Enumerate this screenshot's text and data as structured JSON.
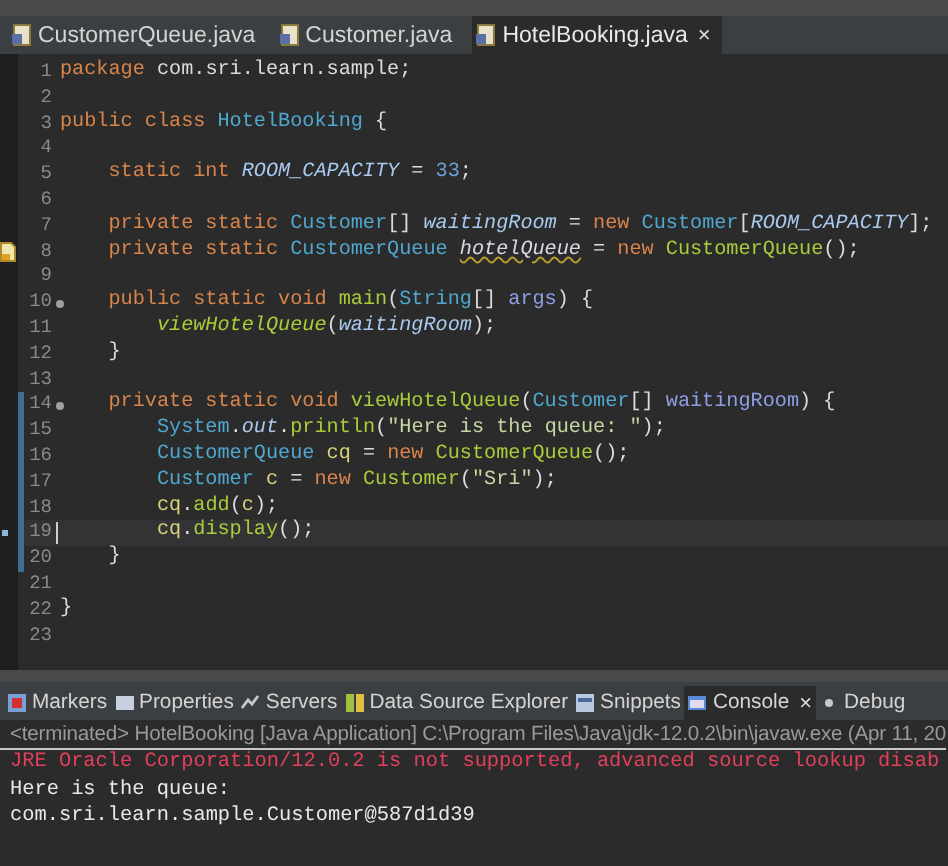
{
  "editor_tabs": [
    {
      "label": "CustomerQueue.java",
      "selected": false
    },
    {
      "label": "Customer.java",
      "selected": false
    },
    {
      "label": "HotelBooking.java",
      "selected": true,
      "close": "×"
    }
  ],
  "code_lines": [
    {
      "number": "1",
      "tokens": [
        {
          "kind": "keyword",
          "text": "package"
        },
        {
          "kind": "plain",
          "text": " com.sri.learn.sample;"
        }
      ]
    },
    {
      "number": "2"
    },
    {
      "number": "3",
      "tokens": [
        {
          "kind": "keyword",
          "text": "public class "
        },
        {
          "kind": "type",
          "text": "HotelBooking"
        },
        {
          "kind": "plain",
          "text": " {"
        }
      ]
    },
    {
      "number": "4"
    },
    {
      "number": "5",
      "tokens": [
        {
          "kind": "keyword",
          "text": "    static int "
        },
        {
          "kind": "static-field",
          "text": "ROOM_CAPACITY"
        },
        {
          "kind": "plain",
          "text": " = "
        },
        {
          "kind": "number",
          "text": "33"
        },
        {
          "kind": "plain",
          "text": ";"
        }
      ]
    },
    {
      "number": "6"
    },
    {
      "number": "7",
      "tokens": [
        {
          "kind": "keyword",
          "text": "    private static "
        },
        {
          "kind": "type",
          "text": "Customer"
        },
        {
          "kind": "plain",
          "text": "[] "
        },
        {
          "kind": "static-field",
          "text": "waitingRoom"
        },
        {
          "kind": "plain",
          "text": " = "
        },
        {
          "kind": "keyword",
          "text": "new "
        },
        {
          "kind": "type",
          "text": "Customer"
        },
        {
          "kind": "plain",
          "text": "["
        },
        {
          "kind": "static-field",
          "text": "ROOM_CAPACITY"
        },
        {
          "kind": "plain",
          "text": "];"
        }
      ]
    },
    {
      "number": "8",
      "warning": true,
      "tokens": [
        {
          "kind": "keyword",
          "text": "    private static "
        },
        {
          "kind": "type",
          "text": "CustomerQueue "
        },
        {
          "kind": "warning-field",
          "text": "hotelQueue"
        },
        {
          "kind": "plain",
          "text": " = "
        },
        {
          "kind": "keyword",
          "text": "new "
        },
        {
          "kind": "method",
          "text": "CustomerQueue"
        },
        {
          "kind": "plain",
          "text": "();"
        }
      ]
    },
    {
      "number": "9"
    },
    {
      "number": "10",
      "fold": true,
      "tokens": [
        {
          "kind": "keyword",
          "text": "    public static void "
        },
        {
          "kind": "method",
          "text": "main"
        },
        {
          "kind": "plain",
          "text": "("
        },
        {
          "kind": "type",
          "text": "String"
        },
        {
          "kind": "plain",
          "text": "[] "
        },
        {
          "kind": "param",
          "text": "args"
        },
        {
          "kind": "plain",
          "text": ") {"
        }
      ]
    },
    {
      "number": "11",
      "tokens": [
        {
          "kind": "static-method",
          "text": "        viewHotelQueue"
        },
        {
          "kind": "plain",
          "text": "("
        },
        {
          "kind": "static-field",
          "text": "waitingRoom"
        },
        {
          "kind": "plain",
          "text": ");"
        }
      ]
    },
    {
      "number": "12",
      "tokens": [
        {
          "kind": "plain",
          "text": "    }"
        }
      ]
    },
    {
      "number": "13"
    },
    {
      "number": "14",
      "fold": true,
      "changed": true,
      "tokens": [
        {
          "kind": "keyword",
          "text": "    private static void "
        },
        {
          "kind": "method",
          "text": "viewHotelQueue"
        },
        {
          "kind": "plain",
          "text": "("
        },
        {
          "kind": "type",
          "text": "Customer"
        },
        {
          "kind": "plain",
          "text": "[] "
        },
        {
          "kind": "param",
          "text": "waitingRoom"
        },
        {
          "kind": "plain",
          "text": ") {"
        }
      ]
    },
    {
      "number": "15",
      "changed": true,
      "tokens": [
        {
          "kind": "type",
          "text": "        System"
        },
        {
          "kind": "plain",
          "text": "."
        },
        {
          "kind": "static-field",
          "text": "out"
        },
        {
          "kind": "plain",
          "text": "."
        },
        {
          "kind": "method",
          "text": "println"
        },
        {
          "kind": "plain",
          "text": "("
        },
        {
          "kind": "string",
          "text": "\"Here is the queue: \""
        },
        {
          "kind": "plain",
          "text": ");"
        }
      ]
    },
    {
      "number": "16",
      "changed": true,
      "tokens": [
        {
          "kind": "type",
          "text": "        CustomerQueue "
        },
        {
          "kind": "local",
          "text": "cq"
        },
        {
          "kind": "plain",
          "text": " = "
        },
        {
          "kind": "keyword",
          "text": "new "
        },
        {
          "kind": "method",
          "text": "CustomerQueue"
        },
        {
          "kind": "plain",
          "text": "();"
        }
      ]
    },
    {
      "number": "17",
      "changed": true,
      "tokens": [
        {
          "kind": "type",
          "text": "        Customer "
        },
        {
          "kind": "local",
          "text": "c"
        },
        {
          "kind": "plain",
          "text": " = "
        },
        {
          "kind": "keyword",
          "text": "new "
        },
        {
          "kind": "method",
          "text": "Customer"
        },
        {
          "kind": "plain",
          "text": "("
        },
        {
          "kind": "string",
          "text": "\"Sri\""
        },
        {
          "kind": "plain",
          "text": ");"
        }
      ]
    },
    {
      "number": "18",
      "changed": true,
      "tokens": [
        {
          "kind": "local",
          "text": "        cq"
        },
        {
          "kind": "plain",
          "text": "."
        },
        {
          "kind": "method",
          "text": "add"
        },
        {
          "kind": "plain",
          "text": "("
        },
        {
          "kind": "local",
          "text": "c"
        },
        {
          "kind": "plain",
          "text": ");"
        }
      ]
    },
    {
      "number": "19",
      "changed": true,
      "current": true,
      "tokens": [
        {
          "kind": "local",
          "text": "        cq"
        },
        {
          "kind": "plain",
          "text": "."
        },
        {
          "kind": "method",
          "text": "display"
        },
        {
          "kind": "plain",
          "text": "();"
        }
      ]
    },
    {
      "number": "20",
      "changed": true,
      "tokens": [
        {
          "kind": "plain",
          "text": "    }"
        }
      ]
    },
    {
      "number": "21"
    },
    {
      "number": "22",
      "tokens": [
        {
          "kind": "plain",
          "text": "}"
        }
      ]
    },
    {
      "number": "23"
    }
  ],
  "panel_tabs": [
    {
      "label": "Markers",
      "selected": false
    },
    {
      "label": "Properties",
      "selected": false
    },
    {
      "label": "Servers",
      "selected": false
    },
    {
      "label": "Data Source Explorer",
      "selected": false
    },
    {
      "label": "Snippets",
      "selected": false
    },
    {
      "label": "Console",
      "selected": true,
      "close": "×"
    },
    {
      "label": "Debug",
      "selected": false
    }
  ],
  "console": {
    "header": "<terminated> HotelBooking [Java Application] C:\\Program Files\\Java\\jdk-12.0.2\\bin\\javaw.exe (Apr 11, 20",
    "lines": [
      {
        "kind": "error",
        "text": "JRE Oracle Corporation/12.0.2 is not supported, advanced source lookup disab"
      },
      {
        "kind": "output",
        "text": "Here is the queue:"
      },
      {
        "kind": "output",
        "text": "com.sri.learn.sample.Customer@587d1d39"
      }
    ]
  }
}
